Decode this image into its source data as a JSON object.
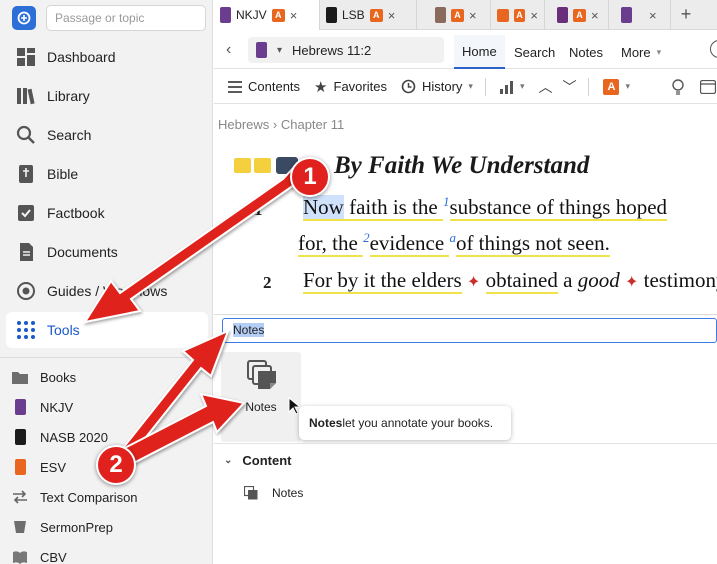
{
  "sidebar": {
    "search_placeholder": "Passage or topic",
    "nav": [
      {
        "label": "Dashboard",
        "icon": "dashboard-icon"
      },
      {
        "label": "Library",
        "icon": "library-icon"
      },
      {
        "label": "Search",
        "icon": "search-icon"
      },
      {
        "label": "Bible",
        "icon": "bible-icon"
      },
      {
        "label": "Factbook",
        "icon": "factbook-icon"
      },
      {
        "label": "Documents",
        "icon": "documents-icon"
      },
      {
        "label": "Guides / Workflows",
        "icon": "guides-icon"
      },
      {
        "label": "Tools",
        "icon": "tools-grid-icon",
        "active": true
      }
    ],
    "books": [
      {
        "label": "Books",
        "icon": "folder-icon"
      },
      {
        "label": "NKJV",
        "icon": "book-cover-icon",
        "color": "#6b3d8f"
      },
      {
        "label": "NASB 2020",
        "icon": "book-cover-icon",
        "color": "#1b1b1b"
      },
      {
        "label": "ESV",
        "icon": "book-cover-icon",
        "color": "#e8661f"
      },
      {
        "label": "Text Comparison",
        "icon": "compare-icon"
      },
      {
        "label": "SermonPrep",
        "icon": "sermonprep-icon"
      },
      {
        "label": "CBV",
        "icon": "book-cover-icon",
        "color": "#777777"
      }
    ]
  },
  "tabs": [
    {
      "label": "NKJV",
      "active": true,
      "cover": "#6b3d8f"
    },
    {
      "label": "LSB",
      "cover": "#1b1b1b"
    },
    {
      "label": "",
      "cover": "#8a6a5a"
    },
    {
      "label": "",
      "cover": "#e8661f"
    },
    {
      "label": "",
      "cover": "#6a2f7a"
    },
    {
      "label": "",
      "cover": "#6b3d8f"
    }
  ],
  "refrow": {
    "reference": "Hebrews 11:2",
    "tabs": [
      "Home",
      "Search",
      "Notes",
      "More"
    ]
  },
  "toolbar": {
    "contents": "Contents",
    "favorites": "Favorites",
    "history": "History"
  },
  "breadcrumb": "Hebrews › Chapter 11",
  "bible": {
    "heading": "By Faith We Understand",
    "v1_num": "1",
    "v1_line1_a": "Now",
    "v1_line1_b": " faith is the ",
    "v1_sup1": "1",
    "v1_line1_c": "substance of things hoped",
    "v1_line2_a": "for, the ",
    "v1_sup2": "2",
    "v1_line2_b": "evidence ",
    "v1_sup3": "a",
    "v1_line2_c": "of things not seen.",
    "v2_num": "2",
    "v2_a": "For by it the ",
    "v2_b": "elders",
    "v2_c": "obtained",
    "v2_d": " a ",
    "v2_e": "good",
    "v2_f": "testimony."
  },
  "panel": {
    "query": "Notes",
    "tile_label": "Notes",
    "tooltip_bold": "Notes",
    "tooltip_rest": " let you annotate your books.",
    "section": "Content",
    "item": "Notes"
  },
  "annotations": {
    "step1": "1",
    "step2": "2",
    "arrow_color": "#e0211d"
  }
}
